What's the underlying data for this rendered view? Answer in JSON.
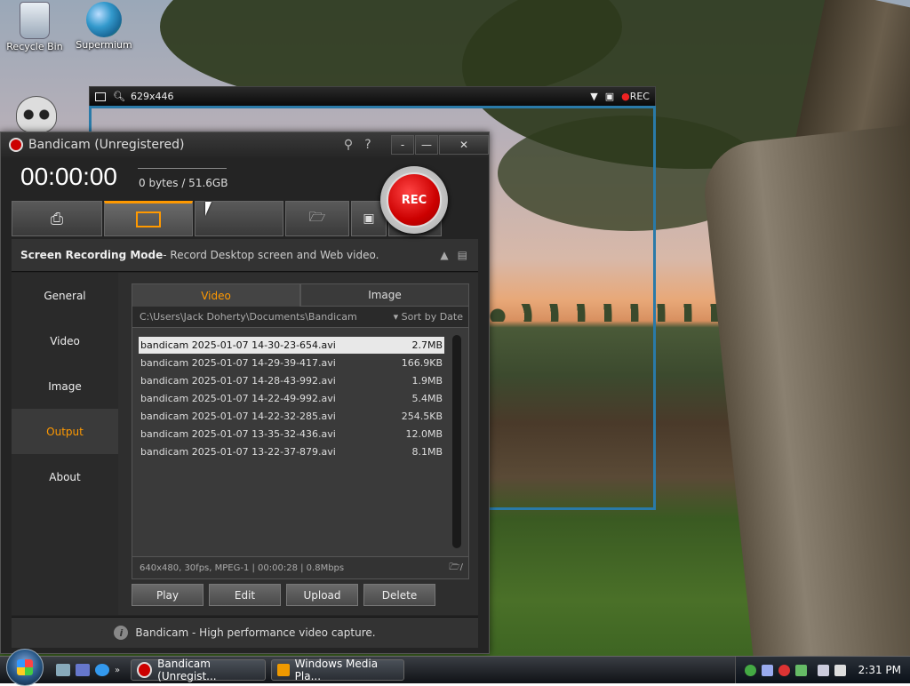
{
  "desktop": {
    "icons": [
      {
        "label": "Recycle Bin"
      },
      {
        "label": "Supermium"
      }
    ]
  },
  "capture": {
    "size": "629x446",
    "rec_label": "REC"
  },
  "window": {
    "title": "Bandicam  (Unregistered)",
    "timer": "00:00:00",
    "size_text": "0 bytes / 51.6GB",
    "rec_button": "REC",
    "mode_title": "Screen Recording Mode",
    "mode_desc": " - Record Desktop screen and Web video.",
    "sidebar": [
      "General",
      "Video",
      "Image",
      "Output",
      "About"
    ],
    "active_sidebar": "Output",
    "tabs": [
      "Video",
      "Image"
    ],
    "path": "C:\\Users\\Jack Doherty\\Documents\\Bandicam",
    "sort": "Sort by Date",
    "files": [
      {
        "name": "bandicam 2025-01-07 14-30-23-654.avi",
        "size": "2.7MB"
      },
      {
        "name": "bandicam 2025-01-07 14-29-39-417.avi",
        "size": "166.9KB"
      },
      {
        "name": "bandicam 2025-01-07 14-28-43-992.avi",
        "size": "1.9MB"
      },
      {
        "name": "bandicam 2025-01-07 14-22-49-992.avi",
        "size": "5.4MB"
      },
      {
        "name": "bandicam 2025-01-07 14-22-32-285.avi",
        "size": "254.5KB"
      },
      {
        "name": "bandicam 2025-01-07 13-35-32-436.avi",
        "size": "12.0MB"
      },
      {
        "name": "bandicam 2025-01-07 13-22-37-879.avi",
        "size": "8.1MB"
      }
    ],
    "file_info": "640x480, 30fps, MPEG-1 | 00:00:28 | 0.8Mbps",
    "actions": [
      "Play",
      "Edit",
      "Upload",
      "Delete"
    ],
    "footer": "Bandicam - High performance video capture."
  },
  "taskbar": {
    "tasks": [
      "Bandicam (Unregist...",
      "Windows Media Pla..."
    ],
    "clock": "2:31 PM"
  },
  "colors": {
    "accent": "#ff9900",
    "capture_frame": "#2a7aa8",
    "rec": "#cc0000"
  }
}
